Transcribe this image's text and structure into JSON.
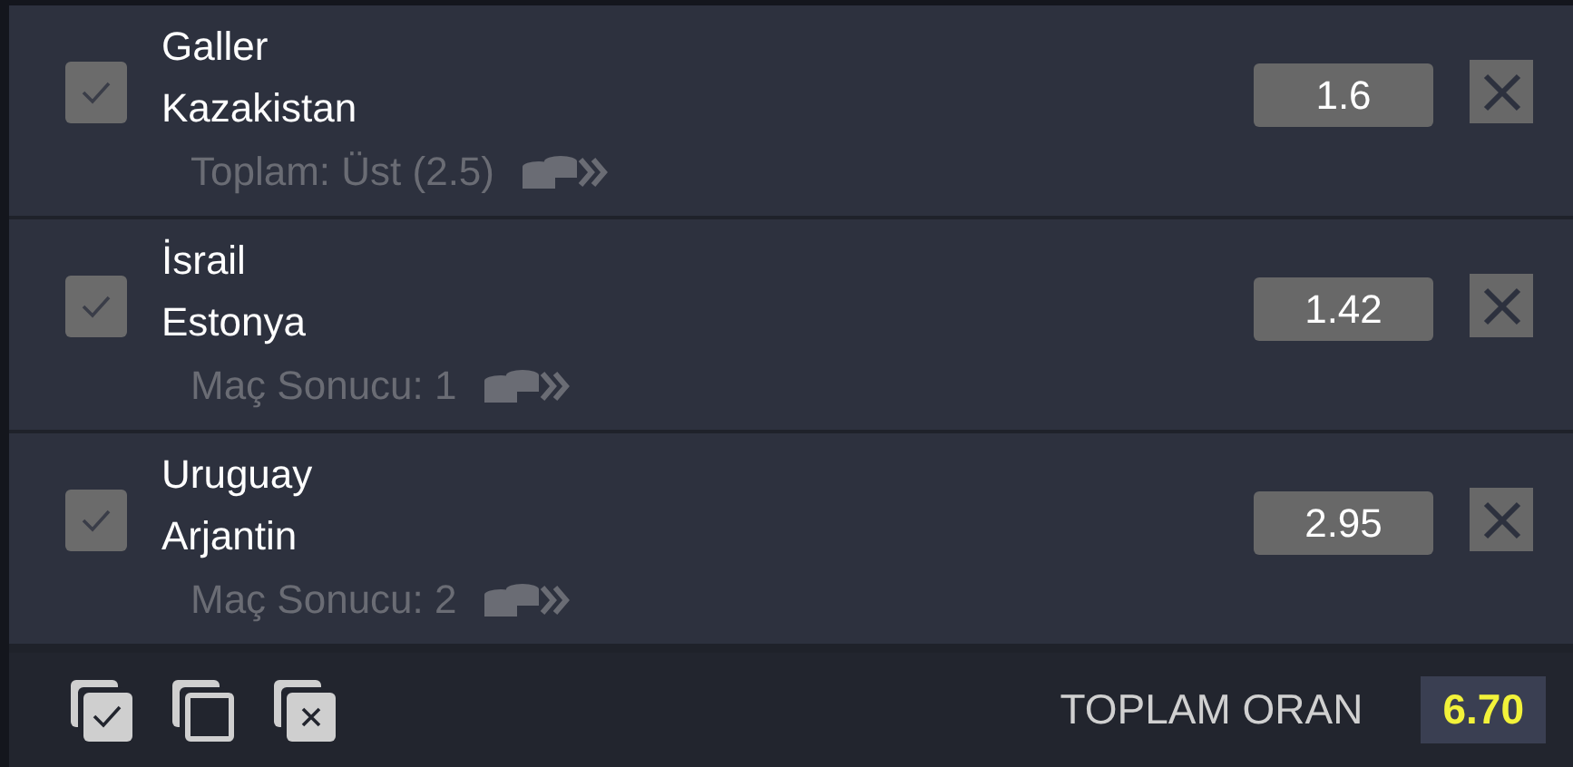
{
  "selections": [
    {
      "teams": [
        "Galler",
        "Kazakistan"
      ],
      "market": "Toplam: Üst (2.5)",
      "odds": "1.6",
      "checked": true
    },
    {
      "teams": [
        "İsrail",
        "Estonya"
      ],
      "market": "Maç Sonucu: 1",
      "odds": "1.42",
      "checked": true
    },
    {
      "teams": [
        "Uruguay",
        "Arjantin"
      ],
      "market": "Maç Sonucu: 2",
      "odds": "2.95",
      "checked": true
    }
  ],
  "footer": {
    "total_label": "TOPLAM ORAN",
    "total_value": "6.70"
  }
}
